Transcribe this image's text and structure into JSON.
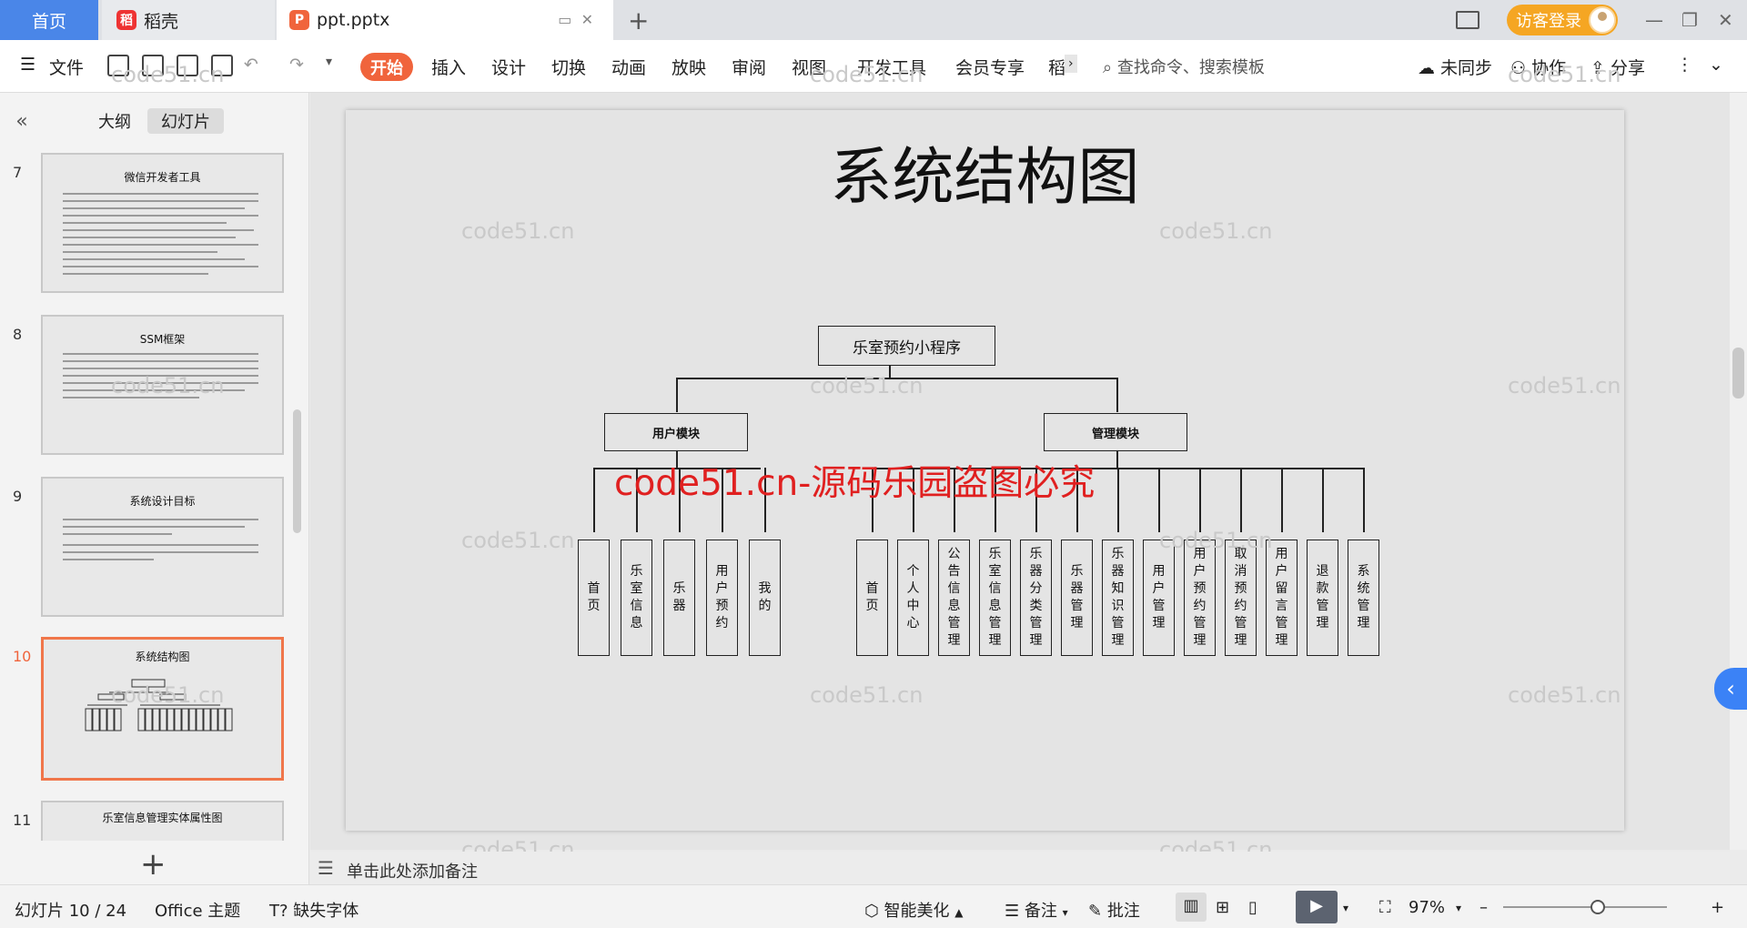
{
  "tabs": {
    "home": "首页",
    "doc1": "稻壳",
    "doc2": "ppt.pptx"
  },
  "titlebar": {
    "login": "访客登录"
  },
  "toolbar": {
    "menu": "文件",
    "start": "开始",
    "items": [
      "插入",
      "设计",
      "切换",
      "动画",
      "放映",
      "审阅",
      "视图",
      "开发工具",
      "会员专享",
      "稻"
    ],
    "search": "查找命令、搜索模板",
    "sync": "未同步",
    "collab": "协作",
    "share": "分享"
  },
  "panel": {
    "tab_outline": "大纲",
    "tab_slides": "幻灯片"
  },
  "thumbs": [
    {
      "num": "7",
      "title": "微信开发者工具"
    },
    {
      "num": "8",
      "title": "SSM框架"
    },
    {
      "num": "9",
      "title": "系统设计目标"
    },
    {
      "num": "10",
      "title": "系统结构图"
    },
    {
      "num": "11",
      "title": "乐室信息管理实体属性图"
    }
  ],
  "slide": {
    "title": "系统结构图",
    "root": "乐室预约小程序",
    "user_module": "用户模块",
    "admin_module": "管理模块",
    "user_leaves": [
      "首页",
      "乐室信息",
      "乐器",
      "用户预约",
      "我的"
    ],
    "admin_leaves": [
      "首页",
      "个人中心",
      "公告信息管理",
      "乐室信息管理",
      "乐器分类管理",
      "乐器管理",
      "乐器知识管理",
      "用户管理",
      "用户预约管理",
      "取消预约管理",
      "用户留言管理",
      "退款管理",
      "系统管理"
    ]
  },
  "watermark": {
    "text": "code51.cn",
    "red": "code51.cn-源码乐园盗图必究"
  },
  "notes": "单击此处添加备注",
  "status": {
    "slide": "幻灯片 10 / 24",
    "theme": "Office 主题",
    "font": "缺失字体",
    "beautify": "智能美化",
    "notes": "备注",
    "comment": "批注",
    "zoom": "97%"
  },
  "colors": {
    "accent": "#f0643c",
    "home_tab": "#4a86e8",
    "login": "#f5a623",
    "watermark_red": "#e02020"
  }
}
